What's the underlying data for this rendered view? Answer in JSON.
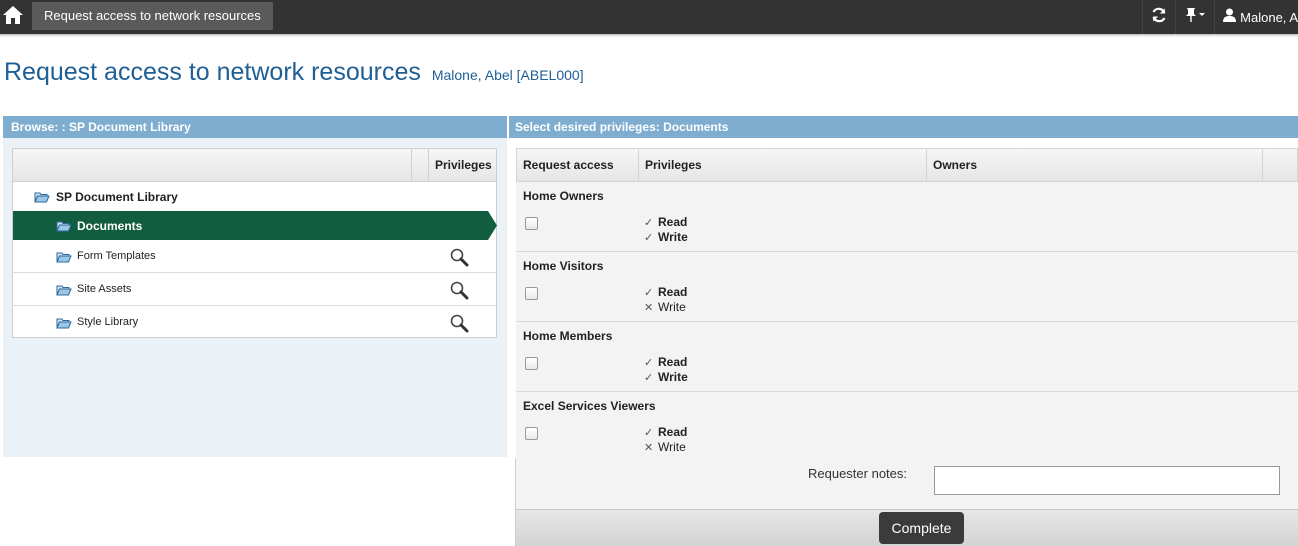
{
  "topbar": {
    "home_icon": "home-icon",
    "tab_label": "Request access to network resources",
    "refresh_icon": "refresh-icon",
    "pin_icon": "pin-icon",
    "user_icon": "user-icon",
    "user_name": "Malone, A"
  },
  "page": {
    "title": "Request access to network resources",
    "subtitle": "Malone, Abel [ABEL000]"
  },
  "browse": {
    "header": "Browse: : SP Document Library",
    "column_privileges": "Privileges",
    "root": "SP Document Library",
    "items": [
      {
        "label": "Documents",
        "selected": true
      },
      {
        "label": "Form Templates"
      },
      {
        "label": "Site Assets"
      },
      {
        "label": "Style Library"
      }
    ]
  },
  "privileges": {
    "header": "Select desired privileges: Documents",
    "columns": [
      "Request access",
      "Privileges",
      "Owners"
    ],
    "groups": [
      {
        "name": "Home Owners",
        "read": "Read",
        "write": "Write",
        "read_granted": true,
        "write_granted": true
      },
      {
        "name": "Home Visitors",
        "read": "Read",
        "write": "Write",
        "read_granted": true,
        "write_granted": false
      },
      {
        "name": "Home Members",
        "read": "Read",
        "write": "Write",
        "read_granted": true,
        "write_granted": true
      },
      {
        "name": "Excel Services Viewers",
        "read": "Read",
        "write": "Write",
        "read_granted": true,
        "write_granted": false
      }
    ],
    "notes_label": "Requester notes:",
    "notes_value": "",
    "complete_label": "Complete"
  },
  "colors": {
    "topbar": "#333333",
    "accent_blue": "#1e5f96",
    "panel_header": "#7eadd0",
    "selected_row": "#125c40"
  }
}
